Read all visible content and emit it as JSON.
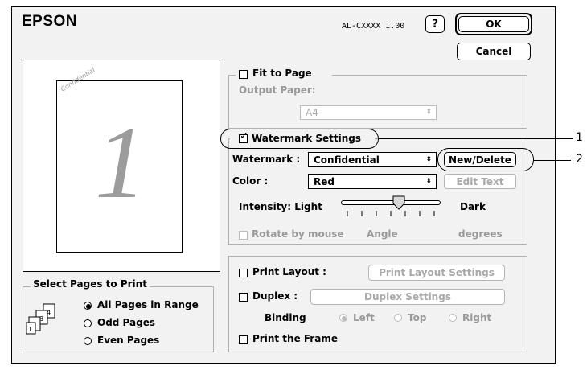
{
  "header": {
    "brand": "EPSON",
    "model": "AL-CXXXX 1.00",
    "help_label": "?",
    "ok_label": "OK",
    "cancel_label": "Cancel"
  },
  "preview": {
    "watermark_text": "Confidential",
    "page_number": "1"
  },
  "select_pages": {
    "title": "Select Pages to Print",
    "options": [
      {
        "label": "All Pages in Range",
        "selected": true
      },
      {
        "label": "Odd Pages",
        "selected": false
      },
      {
        "label": "Even Pages",
        "selected": false
      }
    ]
  },
  "fit_to_page": {
    "label": "Fit to Page",
    "output_paper_label": "Output Paper:",
    "paper_value": "A4"
  },
  "watermark_settings": {
    "label": "Watermark Settings",
    "watermark_label": "Watermark :",
    "watermark_value": "Confidential",
    "new_delete_label": "New/Delete",
    "color_label": "Color :",
    "color_value": "Red",
    "edit_text_label": "Edit Text",
    "intensity_label": "Intensity: Light",
    "intensity_dark": "Dark",
    "rotate_label": "Rotate by mouse",
    "angle_label": "Angle",
    "degrees_label": "degrees"
  },
  "layout": {
    "print_layout_label": "Print Layout :",
    "print_layout_settings_label": "Print Layout Settings",
    "duplex_label": "Duplex :",
    "duplex_settings_label": "Duplex Settings",
    "binding_label": "Binding",
    "binding_options": [
      "Left",
      "Top",
      "Right"
    ],
    "print_frame_label": "Print the Frame"
  },
  "callouts": [
    "1",
    "2"
  ]
}
